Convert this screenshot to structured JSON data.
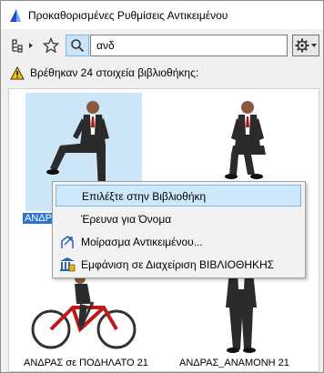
{
  "window": {
    "title": "Προκαθορισμένες Ρυθμίσεις Αντικειμένου"
  },
  "toolbar": {
    "search_value": "ανδ"
  },
  "notice": {
    "text": "Βρέθηκαν 24 στοιχεία βιβλιοθήκης:"
  },
  "results": {
    "items": [
      {
        "label": "ΑΝΔΡ"
      },
      {
        "label": "ΑΝΔΡΑΣ σε ΠΟΔΗΛΑΤΟ 21"
      },
      {
        "label": "ΑΝΔΡΑΣ_ΑΝΑΜΟΝΗ 21"
      }
    ]
  },
  "context_menu": {
    "items": [
      {
        "label": "Επιλέξτε στην Βιβλιοθήκη"
      },
      {
        "label": "Έρευνα για Όνομα"
      },
      {
        "label": "Μοίρασμα Αντικειμένου..."
      },
      {
        "label": "Εμφάνιση σε Διαχείριση ΒΙΒΛΙΟΘΗΚΗΣ"
      }
    ]
  },
  "colors": {
    "selection": "#cde6f7",
    "menu_highlight": "#cde8fb",
    "label_highlight": "#3074c9",
    "warning": "#f5c400"
  }
}
